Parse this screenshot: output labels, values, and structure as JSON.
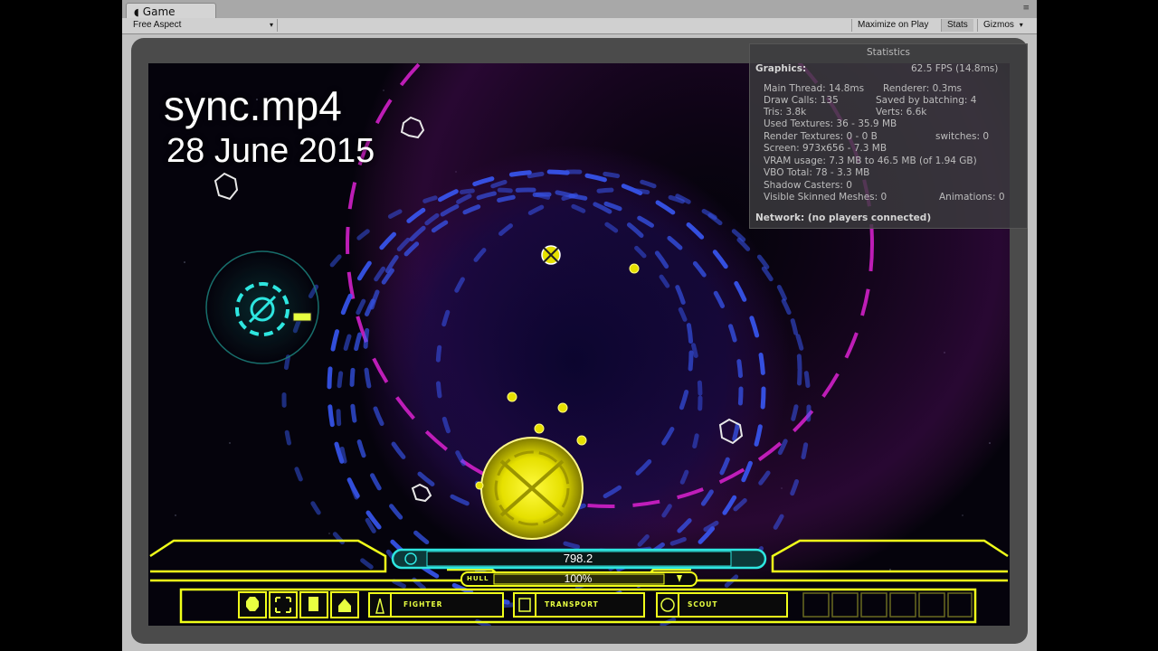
{
  "editor": {
    "tab_label": "Game",
    "tab_icon": "unity-icon",
    "tab_menu_icon": "≡",
    "aspect_label": "Free Aspect",
    "aspect_caret": "▾",
    "maximize_label": "Maximize on Play",
    "stats_label": "Stats",
    "gizmos_label": "Gizmos",
    "gizmos_caret": "▾"
  },
  "overlay": {
    "filename": "sync.mp4",
    "date": "28 June 2015"
  },
  "statistics": {
    "title": "Statistics",
    "graphics_label": "Graphics:",
    "fps": "62.5 FPS (14.8ms)",
    "main_thread": "Main Thread: 14.8ms",
    "renderer": "Renderer: 0.3ms",
    "draw_calls": "Draw Calls: 135",
    "saved_by_batching": "Saved by batching: 4",
    "tris": "Tris: 3.8k",
    "verts": "Verts: 6.6k",
    "used_textures": "Used Textures: 36 - 35.9 MB",
    "render_textures": "Render Textures: 0 - 0 B",
    "switches": "switches: 0",
    "screen": "Screen: 973x656 - 7.3 MB",
    "vram": "VRAM usage: 7.3 MB to 46.5 MB (of 1.94 GB)",
    "vbo": "VBO Total: 78 - 3.3 MB",
    "shadow_casters": "Shadow Casters: 0",
    "skinned_meshes": "Visible Skinned Meshes: 0",
    "animations": "Animations: 0",
    "network": "Network: (no players connected)"
  },
  "hud": {
    "resource_value": "798.2",
    "hull_label": "HULL",
    "hull_value": "100%",
    "hull_fraction": 1.0,
    "units": [
      {
        "label": "FIGHTER",
        "icon": "fighter-icon"
      },
      {
        "label": "TRANSPORT",
        "icon": "transport-icon"
      },
      {
        "label": "SCOUT",
        "icon": "scout-icon"
      }
    ],
    "action_icons": [
      "stop-icon",
      "expand-icon",
      "fuel-icon",
      "home-icon"
    ]
  },
  "colors": {
    "hud_yellow": "#f0ff1a",
    "cyan": "#2ee6e0",
    "magenta": "#e020d0",
    "blue_swarm": "#3a5cff",
    "space": "#05030c"
  }
}
